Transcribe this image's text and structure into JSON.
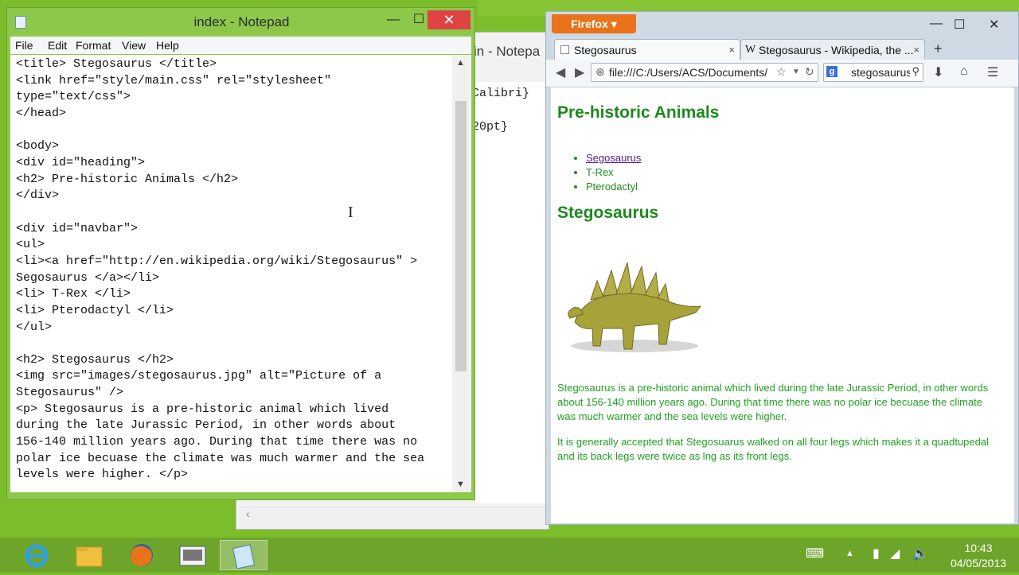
{
  "bg_notepad": {
    "title": "in - Notepa",
    "lines": [
      "Calibri}",
      "20pt}"
    ],
    "scroll_left": "‹"
  },
  "notepad": {
    "title": "index - Notepad",
    "controls": {
      "minimize": "—",
      "maximize": "☐",
      "close": "✕"
    },
    "menu": [
      "File",
      "Edit",
      "Format",
      "View",
      "Help"
    ],
    "code": "<title> Stegosaurus </title>\n<link href=\"style/main.css\" rel=\"stylesheet\"\ntype=\"text/css\">\n</head>\n\n<body>\n<div id=\"heading\">\n<h2> Pre-historic Animals </h2>\n</div>\n\n<div id=\"navbar\">\n<ul>\n<li><a href=\"http://en.wikipedia.org/wiki/Stegosaurus\" >\nSegosaurus </a></li>\n<li> T-Rex </li>\n<li> Pterodactyl </li>\n</ul>\n\n<h2> Stegosaurus </h2>\n<img src=\"images/stegosaurus.jpg\" alt=\"Picture of a\nStegosaurus\" />\n<p> Stegosaurus is a pre-historic animal which lived\nduring the late Jurassic Period, in other words about\n156-140 million years ago. During that time there was no\npolar ice becuase the climate was much warmer and the sea\nlevels were higher. </p>",
    "scroll_up": "▲",
    "scroll_down": "▼"
  },
  "text_cursor": "I",
  "firefox": {
    "menu_button": "Firefox ▾",
    "controls": {
      "minimize": "—",
      "maximize": "☐",
      "close": "✕"
    },
    "tabs": [
      {
        "label": "Stegosaurus",
        "close": "×"
      },
      {
        "label": "Stegosaurus - Wikipedia, the ...",
        "close": "×"
      }
    ],
    "new_tab": "+",
    "url": "file:///C:/Users/ACS/Documents/",
    "search_text": "stegosaurus",
    "search_engine_letter": "g",
    "page": {
      "heading": "Pre-historic Animals",
      "nav_items": [
        "Segosaurus",
        "T-Rex",
        "Pterodactyl"
      ],
      "subheading": "Stegosaurus",
      "paragraph1": "Stegosaurus is a pre-historic animal which lived during the late Jurassic Period, in other words about 156-140 million years ago. During that time there was no polar ice becuase the climate was much warmer and the sea levels were higher.",
      "paragraph2": "It is generally accepted that Stegosuarus walked on all four legs which makes it a quadtupedal and its back legs were twice as lng as its front legs."
    }
  },
  "taskbar": {
    "apps": [
      "internet-explorer",
      "file-explorer",
      "firefox",
      "media",
      "notepad"
    ],
    "time": "10:43",
    "date": "04/05/2013"
  },
  "colors": {
    "desktop": "#7cbd2c",
    "heading_green": "#1d8a1d",
    "firefox_orange": "#e8731a",
    "close_red": "#e04343"
  }
}
